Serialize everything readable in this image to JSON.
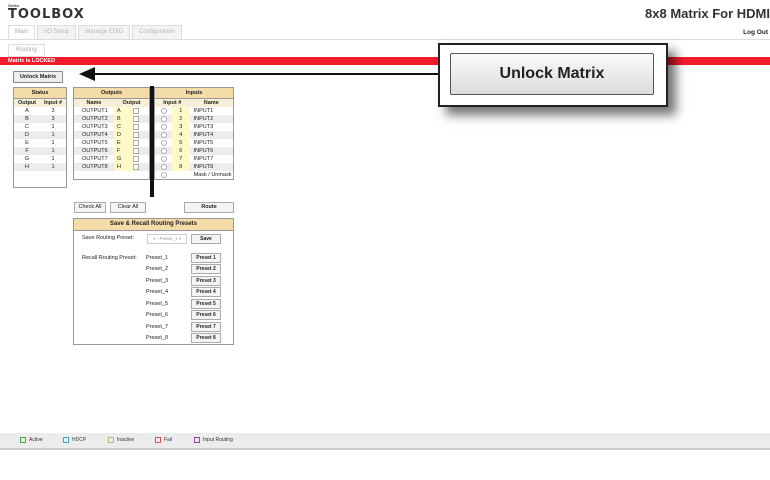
{
  "header": {
    "brand_small": "Gefen",
    "brand": "TOOLBOX",
    "title": "8x8 Matrix For HDMI",
    "logout": "Log Out"
  },
  "tabs": [
    "Main",
    "I/O Setup",
    "Manage EDID",
    "Configuration"
  ],
  "subtab": "Routing",
  "lock_banner": "Matrix is LOCKED",
  "unlock_button": "Unlock Matrix",
  "callout": {
    "label": "Unlock Matrix"
  },
  "status": {
    "title": "Status",
    "col_output": "Output",
    "col_input": "Input #",
    "rows": [
      {
        "output": "A",
        "input": "3"
      },
      {
        "output": "B",
        "input": "3"
      },
      {
        "output": "C",
        "input": "1"
      },
      {
        "output": "D",
        "input": "1"
      },
      {
        "output": "E",
        "input": "1"
      },
      {
        "output": "F",
        "input": "1"
      },
      {
        "output": "G",
        "input": "1"
      },
      {
        "output": "H",
        "input": "1"
      }
    ]
  },
  "outputs": {
    "title": "Outputs",
    "col_name": "Name",
    "col_output": "Output",
    "rows": [
      {
        "name": "OUTPUT1",
        "letter": "A"
      },
      {
        "name": "OUTPUT2",
        "letter": "B"
      },
      {
        "name": "OUTPUT3",
        "letter": "C"
      },
      {
        "name": "OUTPUT4",
        "letter": "D"
      },
      {
        "name": "OUTPUT5",
        "letter": "E"
      },
      {
        "name": "OUTPUT6",
        "letter": "F"
      },
      {
        "name": "OUTPUT7",
        "letter": "G"
      },
      {
        "name": "OUTPUT8",
        "letter": "H"
      }
    ]
  },
  "inputs": {
    "title": "Inputs",
    "col_input": "Input #",
    "col_name": "Name",
    "rows": [
      {
        "num": "1",
        "name": "INPUT1"
      },
      {
        "num": "2",
        "name": "INPUT2"
      },
      {
        "num": "3",
        "name": "INPUT3"
      },
      {
        "num": "4",
        "name": "INPUT4"
      },
      {
        "num": "5",
        "name": "INPUT5"
      },
      {
        "num": "6",
        "name": "INPUT6"
      },
      {
        "num": "7",
        "name": "INPUT7"
      },
      {
        "num": "8",
        "name": "INPUT8"
      }
    ],
    "mask_label": "Mask / Unmask"
  },
  "buttons": {
    "check_all": "Check All",
    "clear_all": "Clear All",
    "route": "Route"
  },
  "presets": {
    "title": "Save & Recall Routing Presets",
    "save_label": "Save Routing Preset:",
    "save_select": "1 - Preset_1",
    "save_button": "Save",
    "recall_label": "Recall Routing Preset:",
    "items": [
      {
        "name": "Preset_1",
        "button": "Preset 1"
      },
      {
        "name": "Preset_2",
        "button": "Preset 2"
      },
      {
        "name": "Preset_3",
        "button": "Preset 3"
      },
      {
        "name": "Preset_4",
        "button": "Preset 4"
      },
      {
        "name": "Preset_5",
        "button": "Preset 5"
      },
      {
        "name": "Preset_6",
        "button": "Preset 6"
      },
      {
        "name": "Preset_7",
        "button": "Preset 7"
      },
      {
        "name": "Preset_8",
        "button": "Preset 8"
      }
    ]
  },
  "legend": [
    {
      "label": "Active",
      "color": "#3cb043"
    },
    {
      "label": "HDCP",
      "color": "#29a9d6"
    },
    {
      "label": "Inactive",
      "color": "#b7b76a"
    },
    {
      "label": "Fail",
      "color": "#d9534f"
    },
    {
      "label": "Input Routing",
      "color": "#8e44ad"
    }
  ],
  "colors": {
    "lock_bar": "#f21b2d",
    "table_header": "#f3dca8"
  }
}
